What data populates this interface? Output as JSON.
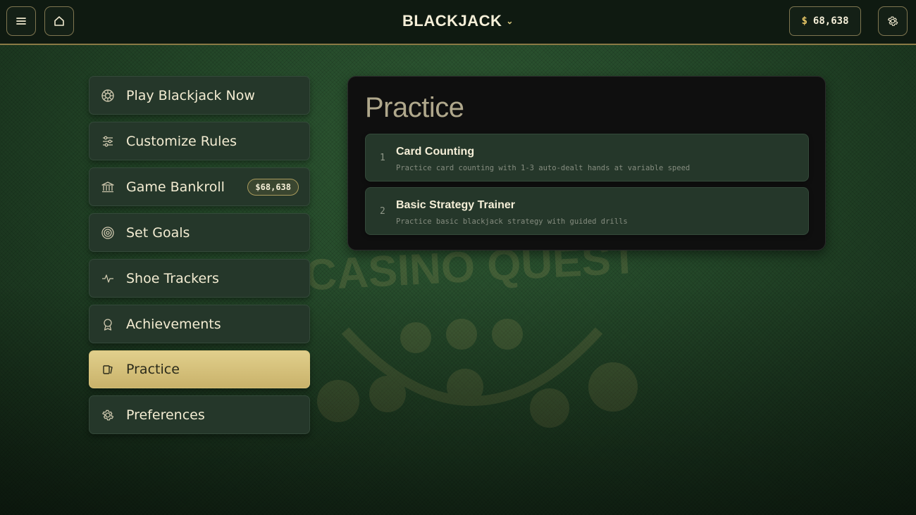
{
  "header": {
    "menu_icon": "hamburger-icon",
    "home_icon": "home-icon",
    "title": "BLACKJACK",
    "title_dropdown_icon": "chevron-down-icon",
    "balance_currency": "$",
    "balance_amount": "68,638",
    "settings_icon": "gear-icon"
  },
  "sidebar": {
    "items": [
      {
        "label": "Play Blackjack Now",
        "icon": "casino-chip-icon"
      },
      {
        "label": "Customize Rules",
        "icon": "sliders-icon"
      },
      {
        "label": "Game Bankroll",
        "icon": "bank-icon",
        "badge": "$68,638"
      },
      {
        "label": "Set Goals",
        "icon": "target-icon"
      },
      {
        "label": "Shoe Trackers",
        "icon": "pulse-icon"
      },
      {
        "label": "Achievements",
        "icon": "award-icon"
      },
      {
        "label": "Practice",
        "icon": "cards-icon",
        "active": true
      },
      {
        "label": "Preferences",
        "icon": "gear-icon"
      }
    ]
  },
  "panel": {
    "title": "Practice",
    "items": [
      {
        "number": "1",
        "title": "Card Counting",
        "description": "Practice card counting with 1-3 auto-dealt hands at variable speed"
      },
      {
        "number": "2",
        "title": "Basic Strategy Trainer",
        "description": "Practice basic blackjack strategy with guided drills"
      }
    ]
  },
  "watermark": {
    "text": "CASINO QUEST"
  },
  "colors": {
    "accent_gold": "#d9c87e",
    "active_item": "#d4c07a",
    "panel_bg": "#0f0f0f",
    "item_bg": "#25372a"
  }
}
